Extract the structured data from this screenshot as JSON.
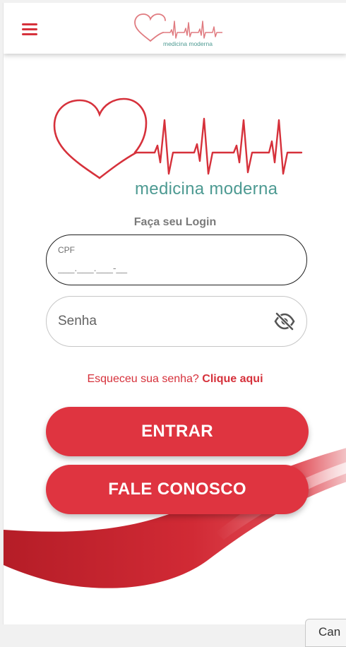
{
  "header": {
    "menu_icon": "hamburger-menu-icon",
    "logo_text": "medicina moderna"
  },
  "logo": {
    "text": "medicina moderna"
  },
  "login": {
    "title": "Faça seu Login",
    "cpf_label": "CPF",
    "cpf_placeholder": "___.___.___-__",
    "senha_placeholder": "Senha",
    "visibility_icon": "eye-off-icon",
    "forgot_text": "Esqueceu sua senha?",
    "forgot_link": "Clique aqui"
  },
  "buttons": {
    "entrar": "ENTRAR",
    "fale_conosco": "FALE CONOSCO"
  },
  "footer": {
    "partial_button": "Can"
  },
  "colors": {
    "brand_red": "#df3440",
    "brand_teal": "#4d9a92"
  }
}
